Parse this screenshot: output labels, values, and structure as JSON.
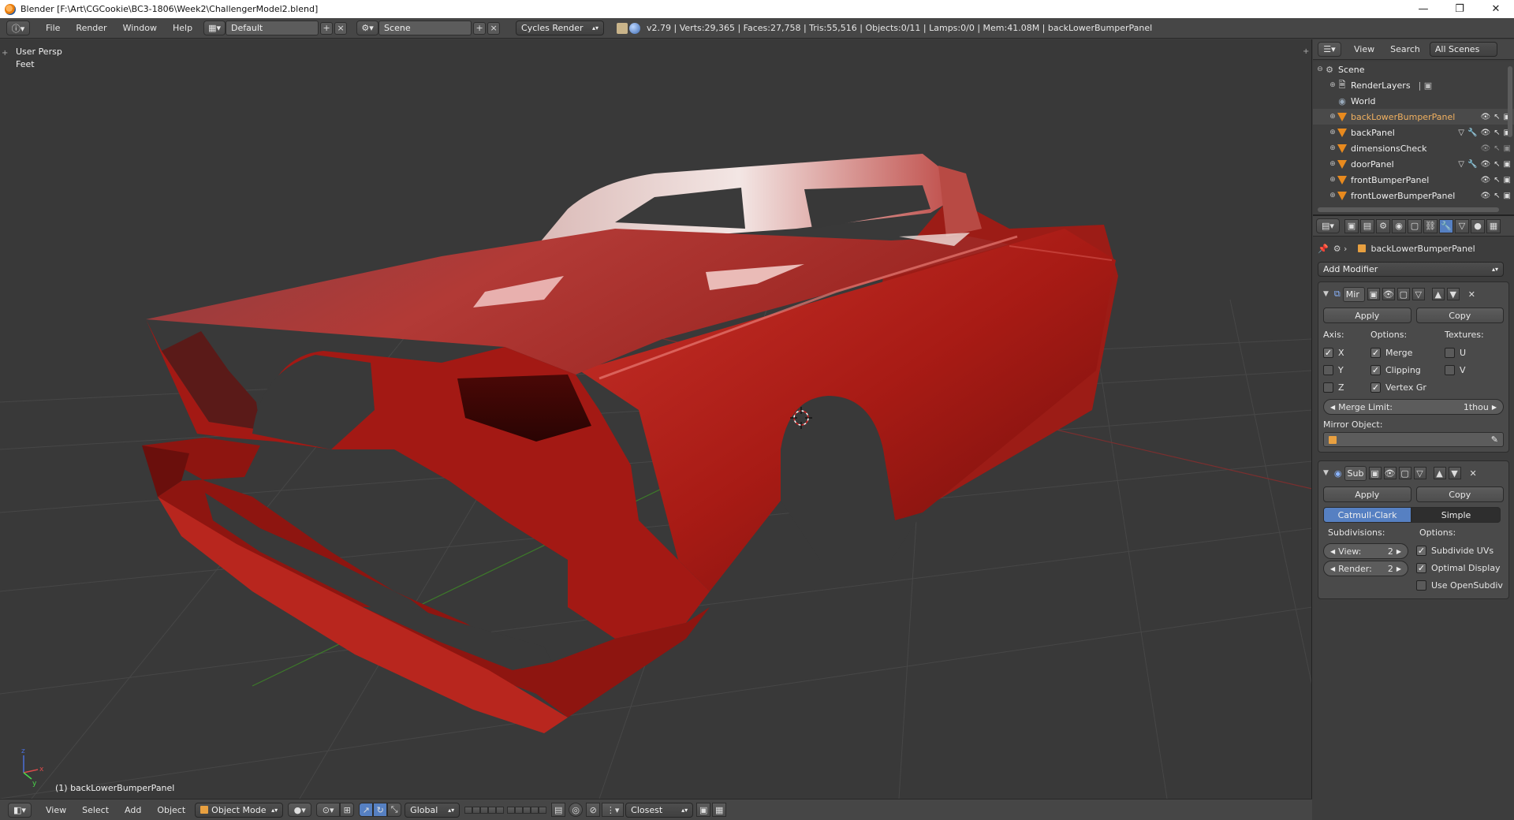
{
  "window": {
    "title": "Blender [F:\\Art\\CGCookie\\BC3-1806\\Week2\\ChallengerModel2.blend]",
    "minimize": "—",
    "maximize": "❐",
    "close": "✕"
  },
  "info_header": {
    "menus": [
      "File",
      "Render",
      "Window",
      "Help"
    ],
    "screen_layout": "Default",
    "scene": "Scene",
    "render_engine": "Cycles Render",
    "stats": "v2.79 | Verts:29,365 | Faces:27,758 | Tris:55,516 | Objects:0/11 | Lamps:0/0 | Mem:41.08M | backLowerBumperPanel"
  },
  "viewport": {
    "view_name": "User Persp",
    "units": "Feet",
    "active_object": "(1) backLowerBumperPanel",
    "model_color": "#b32018"
  },
  "footer": {
    "menus": [
      "View",
      "Select",
      "Add",
      "Object"
    ],
    "mode": "Object Mode",
    "orientation": "Global",
    "snap_target": "Closest"
  },
  "outliner": {
    "menus": [
      "View",
      "Search"
    ],
    "display_mode": "All Scenes",
    "items": [
      {
        "name": "Scene",
        "icon": "scene-icon"
      },
      {
        "name": "RenderLayers",
        "icon": "renderlayers-icon"
      },
      {
        "name": "World",
        "icon": "world-icon"
      },
      {
        "name": "backLowerBumperPanel",
        "icon": "mesh-object-icon"
      },
      {
        "name": "backPanel",
        "icon": "mesh-object-icon"
      },
      {
        "name": "dimensionsCheck",
        "icon": "mesh-object-icon"
      },
      {
        "name": "doorPanel",
        "icon": "mesh-object-icon"
      },
      {
        "name": "frontBumperPanel",
        "icon": "mesh-object-icon"
      },
      {
        "name": "frontLowerBumperPanel",
        "icon": "mesh-object-icon"
      }
    ]
  },
  "properties": {
    "object_name": "backLowerBumperPanel",
    "add_modifier": "Add Modifier",
    "mirror": {
      "name": "Mir",
      "apply": "Apply",
      "copy": "Copy",
      "axis_label": "Axis:",
      "options_label": "Options:",
      "textures_label": "Textures:",
      "axis": [
        "X",
        "Y",
        "Z"
      ],
      "axis_checked": [
        true,
        false,
        false
      ],
      "options": [
        "Merge",
        "Clipping",
        "Vertex Gr"
      ],
      "options_checked": [
        true,
        true,
        true
      ],
      "textures": [
        "U",
        "V"
      ],
      "textures_checked": [
        false,
        false
      ],
      "merge_limit_label": "Merge Limit:",
      "merge_limit_value": "1thou",
      "mirror_object_label": "Mirror Object:"
    },
    "subsurf": {
      "name": "Sub",
      "apply": "Apply",
      "copy": "Copy",
      "catmull": "Catmull-Clark",
      "simple": "Simple",
      "subdivisions_label": "Subdivisions:",
      "options_label": "Options:",
      "view_label": "View:",
      "view_value": "2",
      "render_label": "Render:",
      "render_value": "2",
      "options": [
        "Subdivide UVs",
        "Optimal Display",
        "Use OpenSubdiv"
      ],
      "options_checked": [
        true,
        true,
        false
      ]
    }
  }
}
